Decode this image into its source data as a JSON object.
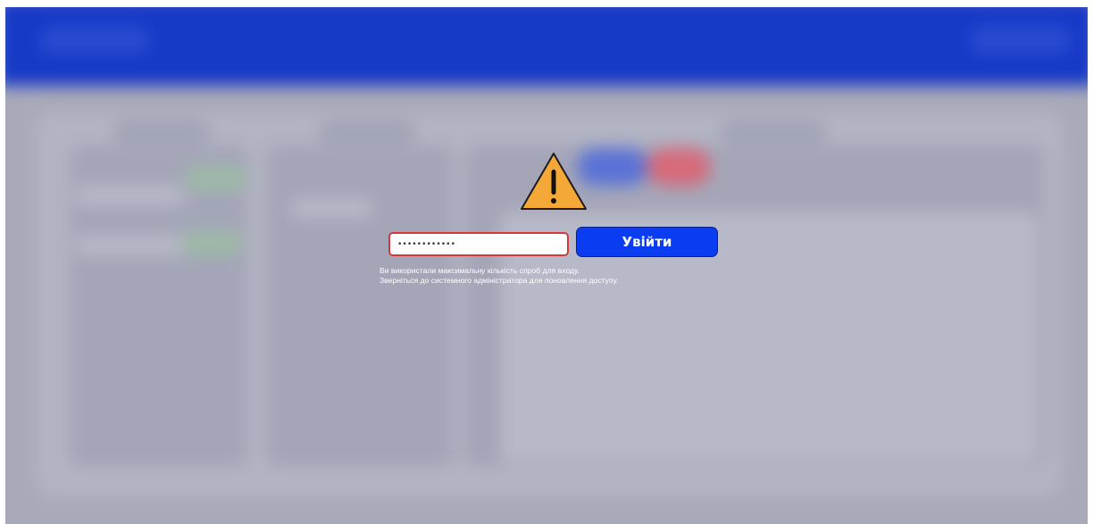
{
  "login": {
    "password_value": "••••••••••••",
    "button_label": "Увійти",
    "error_line_1": "Ви використали максимальну кількість спроб для входу.",
    "error_line_2": "Зверніться до системного адміністратора для поновлення доступу."
  },
  "icons": {
    "warning": "warning-triangle-icon"
  },
  "colors": {
    "header": "#1639c6",
    "button": "#0a3df1",
    "error_border": "#d23a3a",
    "warning_fill": "#f4a838",
    "overlay": "#a9aab9"
  }
}
